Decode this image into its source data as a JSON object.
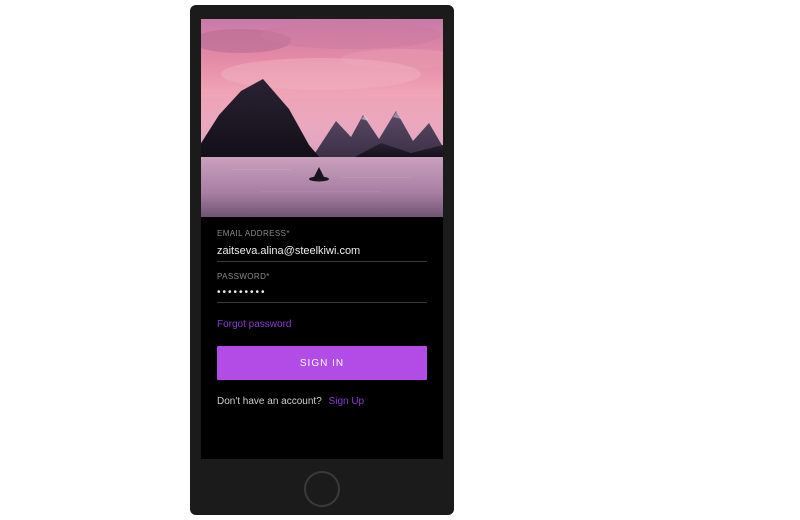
{
  "colors": {
    "accent": "#b24ce6",
    "link": "#8a3ad6",
    "label": "#8a8a8a",
    "phone_body": "#1b1b1b",
    "screen_bg": "#000000"
  },
  "form": {
    "email_label": "EMAIL ADDRESS*",
    "email_value": "zaitseva.alina@steelkiwi.com",
    "password_label": "PASSWORD*",
    "password_masked": "•••••••••",
    "forgot_label": "Forgot password",
    "signin_label": "SIGN IN",
    "signup_prompt": "Don't have an account?",
    "signup_link": "Sign Up"
  }
}
